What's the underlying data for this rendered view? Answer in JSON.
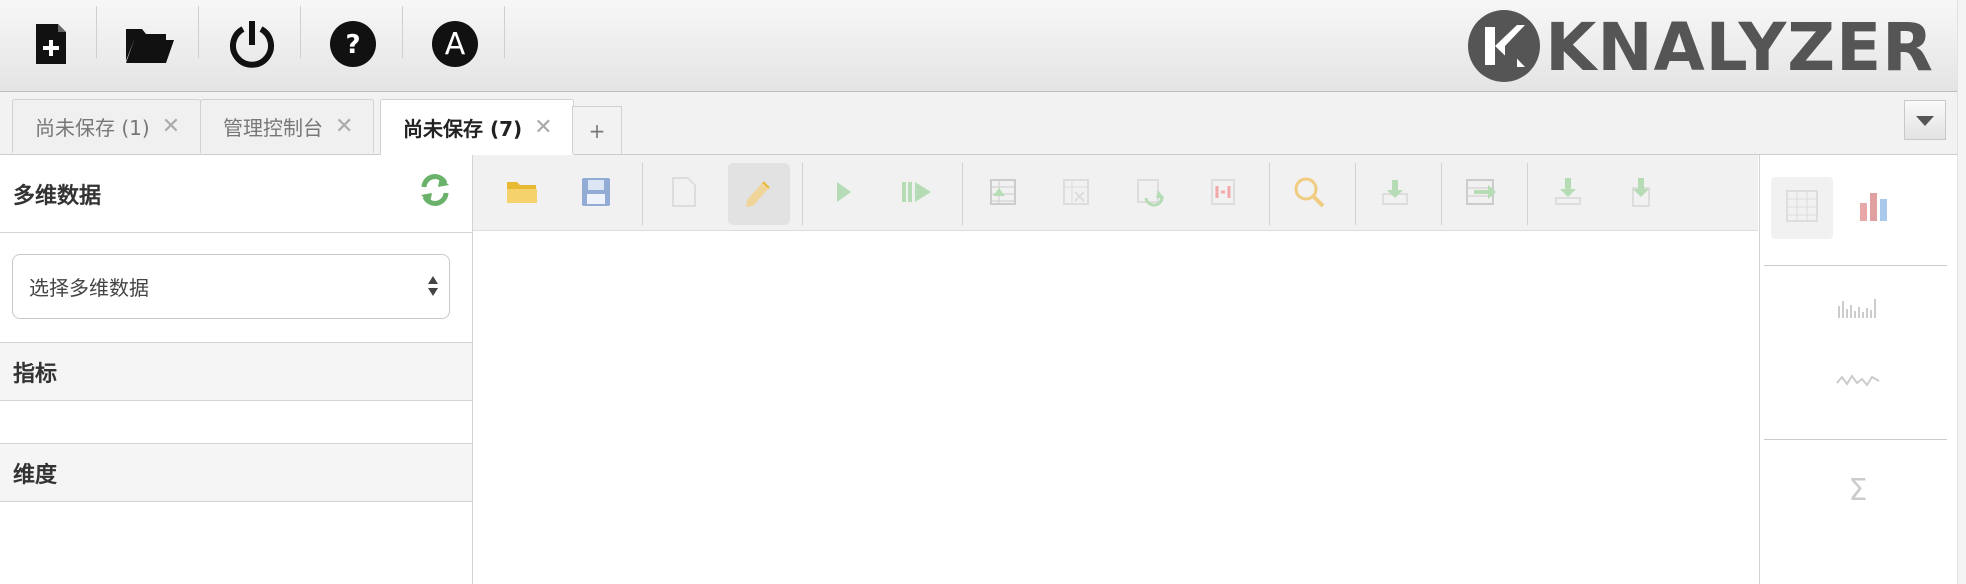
{
  "topbar": {
    "buttons": [
      {
        "name": "new-query",
        "icon": "new-document-icon"
      },
      {
        "name": "open-query",
        "icon": "folder-open-icon"
      },
      {
        "name": "logout",
        "icon": "power-icon"
      },
      {
        "name": "help",
        "icon": "help-icon"
      },
      {
        "name": "about",
        "icon": "about-a-icon"
      }
    ],
    "logo_text": "KNALYZER"
  },
  "tabs": [
    {
      "label": "尚未保存 (1)",
      "active": false
    },
    {
      "label": "管理控制台",
      "active": false
    },
    {
      "label": "尚未保存 (7)",
      "active": true
    }
  ],
  "add_tab_label": "+",
  "close_glyph": "✕",
  "left_panel": {
    "cube_header": "多维数据",
    "cube_select": {
      "value": "选择多维数据",
      "options": [
        "选择多维数据"
      ]
    },
    "measures_header": "指标",
    "dimensions_header": "维度"
  },
  "query_toolbar": {
    "items": [
      "open-icon",
      "save-icon",
      "new-icon",
      "edit-icon",
      "run-icon",
      "run-step-icon",
      "drill-up-icon",
      "remove-icon",
      "swap-icon",
      "hide-parents-icon",
      "search-icon",
      "export-icon",
      "switch-icon",
      "download-icon",
      "download-alt-icon"
    ]
  },
  "right_panel": {
    "icons": [
      "table-view-icon",
      "chart-view-icon",
      "bar-sparkline-icon",
      "line-sparkline-icon",
      "sum-icon"
    ],
    "sum_glyph": "Σ"
  },
  "colors": {
    "green": "#6ab26a",
    "folder_yellow": "#e8b933",
    "save_blue": "#6b8fc9",
    "text": "#333333",
    "chart_red": "#e07a7a",
    "chart_blue": "#7aa8e0"
  }
}
